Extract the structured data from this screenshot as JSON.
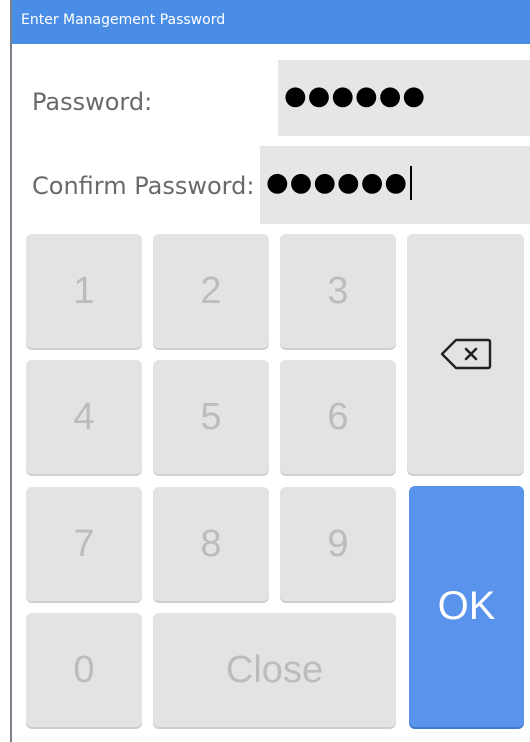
{
  "window": {
    "title": "Enter Management Password"
  },
  "fields": {
    "password": {
      "label": "Password:",
      "value": "●●●●●●"
    },
    "confirm": {
      "label": "Confirm Password:",
      "value": "●●●●●●"
    }
  },
  "keypad": {
    "keys": [
      "1",
      "2",
      "3",
      "4",
      "5",
      "6",
      "7",
      "8",
      "9",
      "0"
    ],
    "close": "Close",
    "ok": "OK",
    "backspace_icon": "backspace-icon"
  },
  "colors": {
    "titlebar": "#4a8de6",
    "ok_button": "#5a93ec",
    "key_bg": "#e3e3e3",
    "field_bg": "#e6e6e6"
  }
}
